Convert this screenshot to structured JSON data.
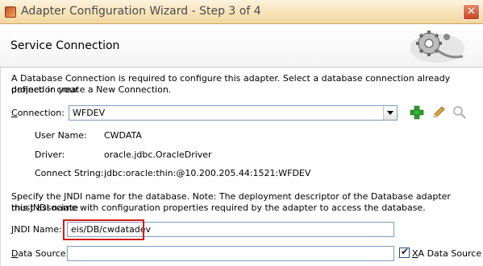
{
  "window": {
    "title": "Adapter Configuration Wizard - Step 3 of 4",
    "close_glyph": "✕"
  },
  "header": {
    "title": "Service Connection"
  },
  "intro": {
    "line1": "A Database Connection is required to configure this adapter. Select a database connection already defined in your",
    "line2": "project or create a New Connection."
  },
  "connection": {
    "label_first": "C",
    "label_rest": "onnection:",
    "value": "WFDEV",
    "icons": [
      "add-icon",
      "edit-icon",
      "search-icon"
    ],
    "details": [
      {
        "label": "User Name:",
        "value": "CWDATA"
      },
      {
        "label": "Driver:",
        "value": "oracle.jdbc.OracleDriver"
      },
      {
        "label": "Connect String:",
        "value": "jdbc:oracle:thin:@10.200.205.44:1521:WFDEV"
      }
    ]
  },
  "jndi_intro": {
    "line1": "Specify the JNDI name for the database.  Note: The deployment descriptor of the Database adapter must associate",
    "line2": "this JNDI name with configuration properties required by the adapter to access the database."
  },
  "jndi": {
    "label_first": "J",
    "label_rest": "NDI Name:",
    "value": "eis/DB/cwdatadev"
  },
  "datasource": {
    "label_first": "D",
    "label_rest": "ata Source:",
    "value": "",
    "xa_checked": true,
    "xa_label_first": "X",
    "xa_label_rest": "A Data Source"
  },
  "colors": {
    "highlight": "#d01c1c",
    "add_green": "#2e9a2e",
    "field_border": "#7f9db9"
  }
}
